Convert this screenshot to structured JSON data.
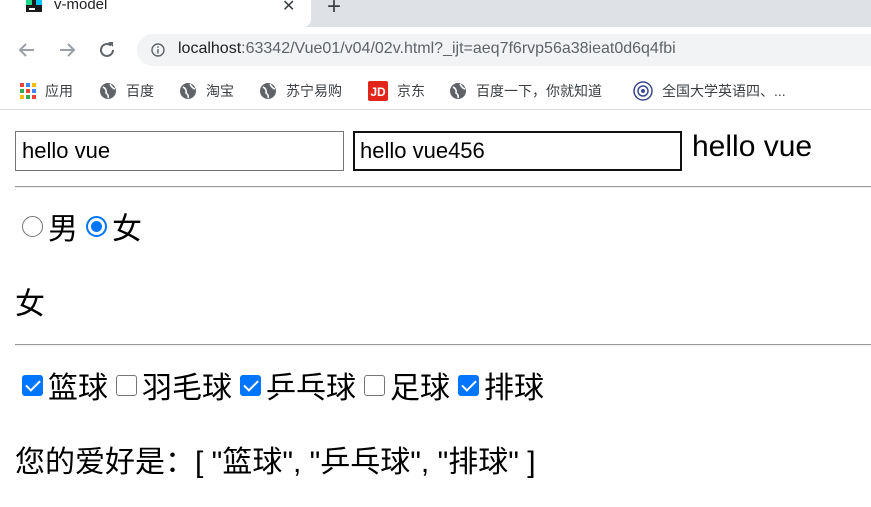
{
  "browser": {
    "tab": {
      "title": "v-model",
      "close": "✕"
    },
    "new_tab": "+",
    "address": {
      "host": "localhost",
      "rest": ":63342/Vue01/v04/02v.html?_ijt=aeq7f6rvp56a38ieat0d6q4fbi"
    },
    "bookmarks": [
      {
        "label": "应用",
        "icon": "apps-grid-icon"
      },
      {
        "label": "百度",
        "icon": "globe-icon"
      },
      {
        "label": "淘宝",
        "icon": "globe-icon"
      },
      {
        "label": "苏宁易购",
        "icon": "globe-icon"
      },
      {
        "label": "京东",
        "icon": "jd-logo-icon"
      },
      {
        "label": "百度一下，你就知道",
        "icon": "globe-icon"
      },
      {
        "label": "全国大学英语四、...",
        "icon": "emblem-icon"
      }
    ]
  },
  "page": {
    "text_inputs": [
      {
        "value": "hello vue"
      },
      {
        "value": "hello vue456"
      }
    ],
    "echo_text": "hello vue",
    "gender": {
      "options": [
        {
          "label": "男",
          "checked": false
        },
        {
          "label": "女",
          "checked": true
        }
      ],
      "selected_text": "女"
    },
    "hobbies": {
      "options": [
        {
          "label": "篮球",
          "checked": true
        },
        {
          "label": "羽毛球",
          "checked": false
        },
        {
          "label": "乒乓球",
          "checked": true
        },
        {
          "label": "足球",
          "checked": false
        },
        {
          "label": "排球",
          "checked": true
        }
      ],
      "result_text": "您的爱好是：[ \"篮球\", \"乒乓球\", \"排球\" ]"
    },
    "colors": {
      "accent": "#0075ff",
      "jd_red": "#e1251b"
    }
  }
}
